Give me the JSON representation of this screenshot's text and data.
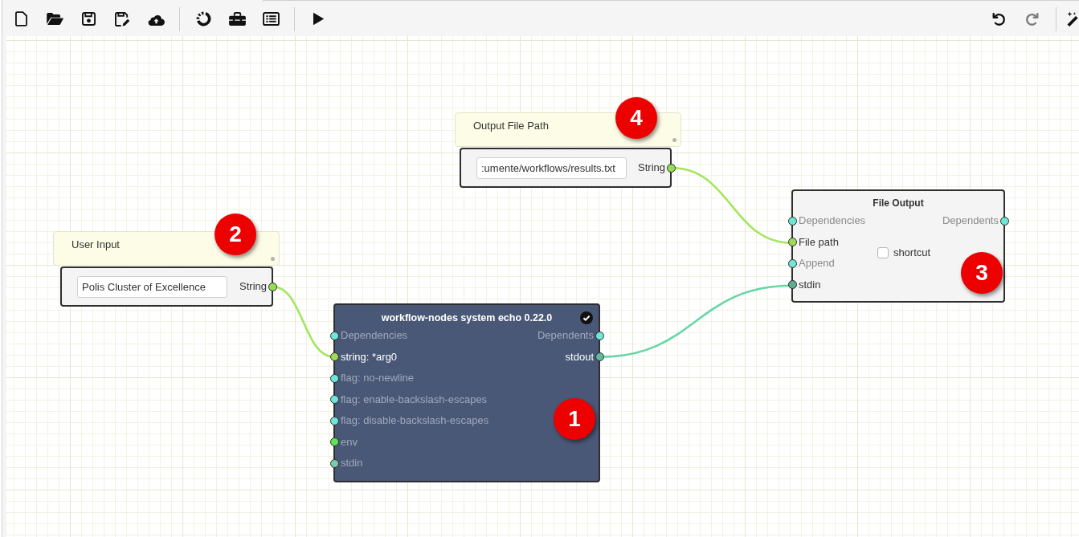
{
  "toolbar": {
    "left_groups": [
      {
        "buttons": [
          {
            "kind": "new",
            "disabled": false
          },
          {
            "kind": "open",
            "disabled": false
          },
          {
            "kind": "save",
            "disabled": false
          },
          {
            "kind": "saveas",
            "disabled": false
          },
          {
            "kind": "upload",
            "disabled": false
          }
        ]
      },
      {
        "buttons": [
          {
            "kind": "spinner",
            "disabled": false
          },
          {
            "kind": "toolbox",
            "disabled": false
          },
          {
            "kind": "list",
            "disabled": false
          }
        ]
      },
      {
        "buttons": [
          {
            "kind": "run",
            "disabled": false
          }
        ]
      }
    ],
    "right_groups": [
      {
        "buttons": [
          {
            "kind": "undo",
            "disabled": false
          },
          {
            "kind": "redo",
            "disabled": true
          }
        ]
      },
      {
        "buttons": [
          {
            "kind": "wand",
            "disabled": false
          }
        ]
      }
    ]
  },
  "canvas": {
    "nodes": [
      {
        "kind": "input",
        "note": "Output File Path",
        "marker": "4",
        "value": ":umente/workflows/results.txt",
        "outputs": [
          {
            "label": "String",
            "color": "#93dd55",
            "connected": true
          }
        ]
      },
      {
        "kind": "input",
        "note": "User Input",
        "marker": "2",
        "value": "Polis Cluster of Excellence",
        "outputs": [
          {
            "label": "String",
            "color": "#93dd55",
            "connected": true
          }
        ]
      },
      {
        "kind": "builtin",
        "title": "File Output",
        "marker": "3",
        "inputs": [
          {
            "label": "Dependencies",
            "color": "#6fe6d6",
            "connected": false
          },
          {
            "label": "File path",
            "color": "#9fd957",
            "connected": true
          },
          {
            "label": "Append",
            "color": "#6fe6d6",
            "connected": false
          },
          {
            "label": "stdin",
            "color": "#5fae92",
            "connected": true
          }
        ],
        "option": {
          "label": "shortcut",
          "checked": false
        },
        "outputs": [
          {
            "label": "Dependents",
            "color": "#6fe6d6",
            "connected": false
          }
        ]
      },
      {
        "kind": "tool",
        "title": "workflow-nodes system echo 0.22.0",
        "verified": true,
        "marker": "1",
        "inputs": [
          {
            "label": "Dependencies",
            "color": "#6fe6d6",
            "connected": false
          },
          {
            "label": "string: *arg0",
            "color": "#9fd957",
            "connected": true
          },
          {
            "label": "flag: no-newline",
            "color": "#6fe6d6",
            "connected": false
          },
          {
            "label": "flag: enable-backslash-escapes",
            "color": "#6fe6d6",
            "connected": false
          },
          {
            "label": "flag: disable-backslash-escapes",
            "color": "#6fe6d6",
            "connected": false
          },
          {
            "label": "env",
            "color": "#5ee35b",
            "connected": false
          },
          {
            "label": "stdin",
            "color": "#79cbb0",
            "connected": false
          }
        ],
        "outputs": [
          {
            "label": "Dependents",
            "color": "#6fe6d6",
            "connected": false
          },
          {
            "label": "stdout",
            "color": "#5fbb9d",
            "connected": true
          }
        ]
      }
    ],
    "connections": [
      {
        "color": "#a2e65b"
      },
      {
        "color": "#64d6a6"
      },
      {
        "color": "#a2e65b"
      }
    ]
  }
}
